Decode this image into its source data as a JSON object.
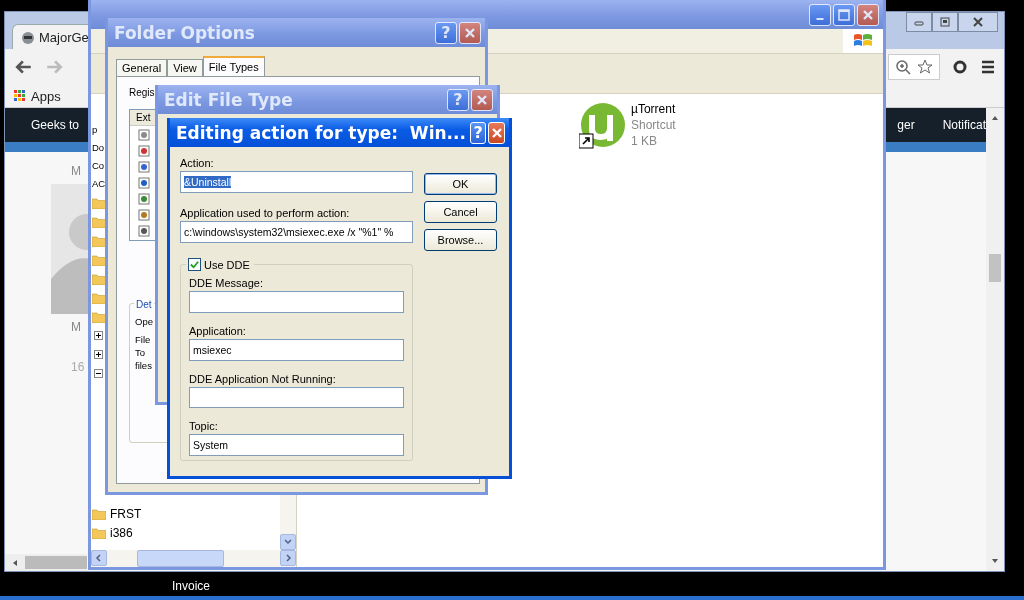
{
  "desktop": {
    "icon_labels": [
      "Invoice"
    ]
  },
  "browser": {
    "tab_title": "MajorGe",
    "bookmarks": [
      "Apps"
    ],
    "nav_left": "Geeks to",
    "nav_right": [
      "ger",
      "Notificat"
    ],
    "page_texts": [
      "M",
      "M",
      "16"
    ]
  },
  "explorer": {
    "tree_fragments": [
      "p",
      "Do",
      "Co",
      "AC"
    ],
    "expanders": [
      {
        "expanded": false
      },
      {
        "expanded": false
      },
      {
        "expanded": true
      }
    ],
    "folders": [
      "FRST",
      "i386"
    ],
    "file": {
      "name": "µTorrent",
      "type": "Shortcut",
      "size": "1 KB"
    }
  },
  "folder_options": {
    "title": "Folder Options",
    "help_label": "?",
    "tabs": [
      {
        "label": "General",
        "selected": false
      },
      {
        "label": "View",
        "selected": false
      },
      {
        "label": "File Types",
        "selected": true
      }
    ],
    "list_label": "Regis",
    "list_header": "Ext",
    "details_legend": "Det",
    "details_texts": [
      "Ope",
      "File",
      "To",
      "files"
    ]
  },
  "edit_file_type": {
    "title": "Edit File Type",
    "help_label": "?"
  },
  "action_dialog": {
    "title": "Editing action for type:  Win...",
    "help_label": "?",
    "fields": [
      {
        "label": "Action:",
        "value": "&Uninstall",
        "value_selected": true
      },
      {
        "label": "Application used to perform action:",
        "value": "c:\\windows\\system32\\msiexec.exe /x \"%1\" %",
        "value_selected": false
      }
    ],
    "use_dde": {
      "label": "Use DDE",
      "checked": true
    },
    "dde_fields": [
      {
        "label": "DDE Message:"
      },
      {
        "label": "Application:",
        "value": "msiexec"
      },
      {
        "label": "DDE Application Not Running:"
      },
      {
        "label": "Topic:",
        "value": "System"
      }
    ],
    "buttons": [
      "OK",
      "Cancel",
      "Browse..."
    ]
  }
}
